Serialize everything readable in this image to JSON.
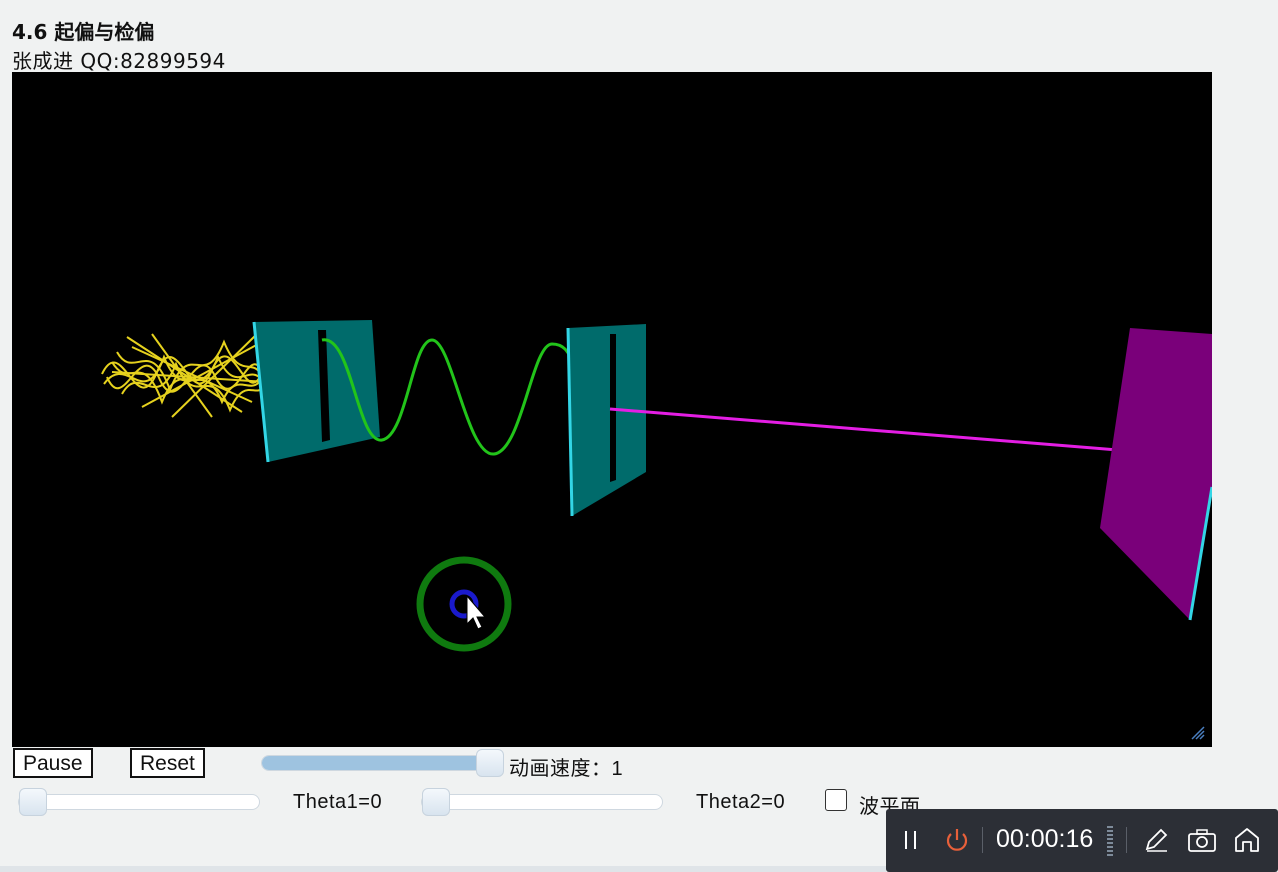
{
  "header": {
    "title": "4.6 起偏与检偏",
    "author": "张成进  QQ:82899594"
  },
  "controls": {
    "pause_label": "Pause",
    "reset_label": "Reset",
    "speed_label": "动画速度：1",
    "speed_value": 1,
    "theta1_label": "Theta1=0",
    "theta1_value": 0,
    "theta2_label": "Theta2=0",
    "theta2_value": 0,
    "wavefront_label": "波平面",
    "wavefront_checked": false
  },
  "recorder": {
    "time": "00:00:16"
  },
  "icons": {
    "pause": "pause-icon",
    "power": "power-icon",
    "pen": "pen-icon",
    "camera": "camera-icon",
    "home": "home-icon"
  },
  "colors": {
    "polarizer": "#006b6b",
    "polarizer_edge": "#33d6e6",
    "wave": "#22c41a",
    "beam": "#e41ee4",
    "screen": "#7a007a",
    "unpolarized": "#e6d21e",
    "rotate_ring": "#0f7a0f",
    "rotate_center": "#1a1acc",
    "recorder_power": "#e8603a"
  }
}
